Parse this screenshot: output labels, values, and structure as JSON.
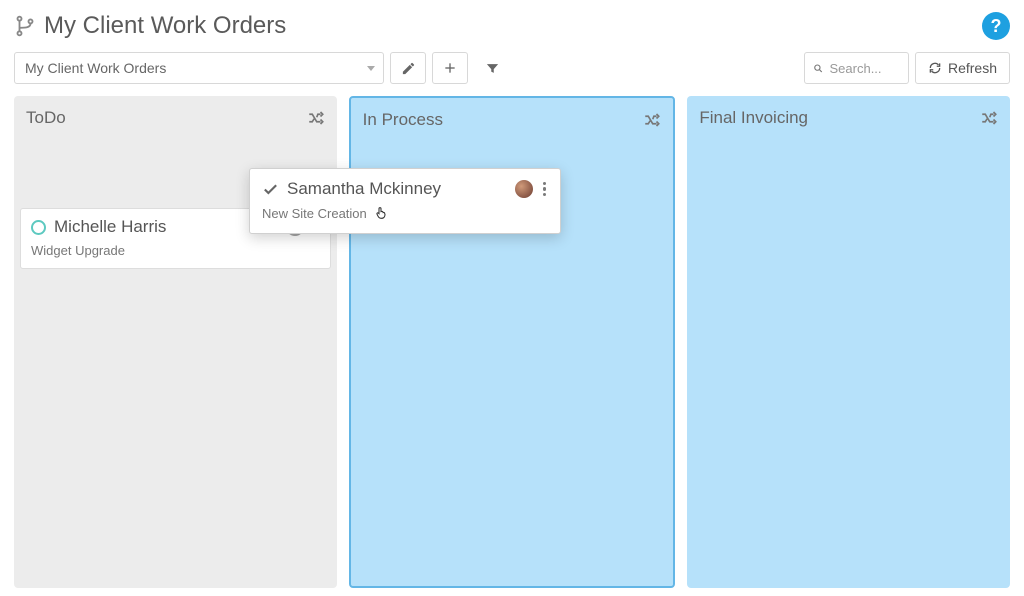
{
  "header": {
    "title": "My Client Work Orders"
  },
  "toolbar": {
    "view_label": "My Client Work Orders",
    "search_placeholder": "Search...",
    "refresh_label": "Refresh"
  },
  "columns": [
    {
      "title": "ToDo"
    },
    {
      "title": "In Process"
    },
    {
      "title": "Final Invoicing"
    }
  ],
  "cards": {
    "todo_card": {
      "title": "Michelle Harris",
      "subtitle": "Widget Upgrade"
    },
    "dragging_card": {
      "title": "Samantha Mckinney",
      "subtitle": "New Site Creation"
    }
  }
}
